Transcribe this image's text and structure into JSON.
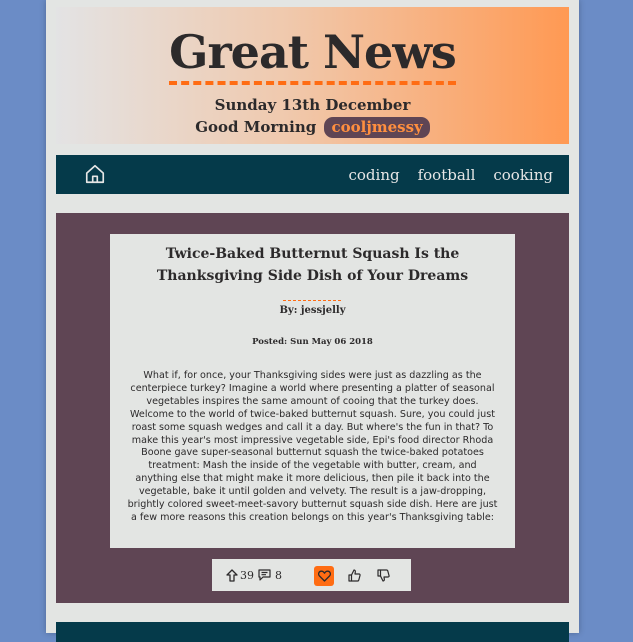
{
  "header": {
    "title": "Great News",
    "date": "Sunday 13th December",
    "greeting": "Good Morning",
    "username": "cooljmessy"
  },
  "nav": {
    "home_icon": "home-icon",
    "links": [
      "coding",
      "football",
      "cooking"
    ]
  },
  "article": {
    "title": "Twice-Baked Butternut Squash Is the Thanksgiving Side Dish of Your Dreams",
    "byline": "By: jessjelly",
    "posted": "Posted: Sun May 06 2018",
    "body": "What if, for once, your Thanksgiving sides were just as dazzling as the centerpiece turkey? Imagine a world where presenting a platter of seasonal vegetables inspires the same amount of cooing that the turkey does. Welcome to the world of twice-baked butternut squash. Sure, you could just roast some squash wedges and call it a day. But where's the fun in that? To make this year's most impressive vegetable side, Epi's food director Rhoda Boone gave super-seasonal butternut squash the twice-baked potatoes treatment: Mash the inside of the vegetable with butter, cream, and anything else that might make it more delicious, then pile it back into the vegetable, bake it until golden and velvety. The result is a jaw-dropping, brightly colored sweet-meet-savory butternut squash side dish. Here are just a few more reasons this creation belongs on this year's Thanksgiving table:",
    "votes": "39",
    "comments": "8"
  },
  "colors": {
    "accent": "#ff6c13",
    "nav_bg": "#053a4a",
    "card_bg": "#5f4554",
    "page_bg": "#e3e5e3",
    "body_bg": "#6b8cc6"
  }
}
